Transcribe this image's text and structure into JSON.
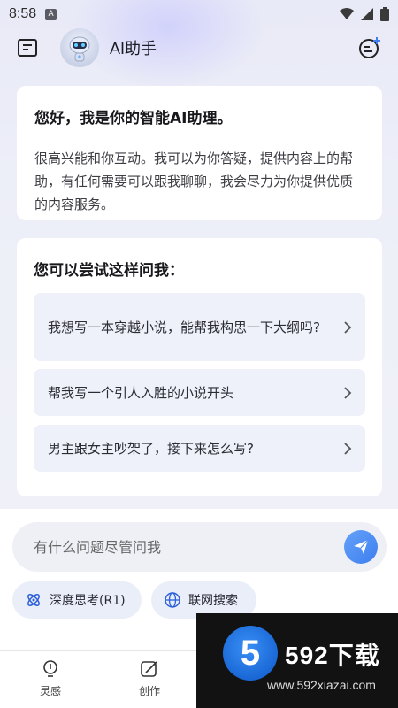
{
  "status": {
    "time": "8:58",
    "notif": "A"
  },
  "header": {
    "title": "AI助手"
  },
  "welcome": {
    "heading": "您好，我是你的智能AI助理。",
    "body": "很高兴能和你互动。我可以为你答疑，提供内容上的帮助，有任何需要可以跟我聊聊，我会尽力为你提供优质的内容服务。"
  },
  "suggestions": {
    "heading": "您可以尝试这样问我：",
    "items": [
      {
        "label": "我想写一本穿越小说，能帮我构思一下大纲吗?"
      },
      {
        "label": "帮我写一个引人入胜的小说开头"
      },
      {
        "label": "男主跟女主吵架了，接下来怎么写?"
      }
    ]
  },
  "input": {
    "placeholder": "有什么问题尽管问我"
  },
  "chips": {
    "deep_think": "深度思考(R1)",
    "web_search": "联网搜索"
  },
  "tabs": [
    {
      "label": "灵感"
    },
    {
      "label": "创作"
    }
  ],
  "watermark": {
    "digit": "5",
    "brand": "592下载",
    "url": "www.592xiazai.com"
  },
  "colors": {
    "accent": "#3e7ef0",
    "suggest_bg": "#eef0fa",
    "page_bg": "#eef0f8"
  }
}
